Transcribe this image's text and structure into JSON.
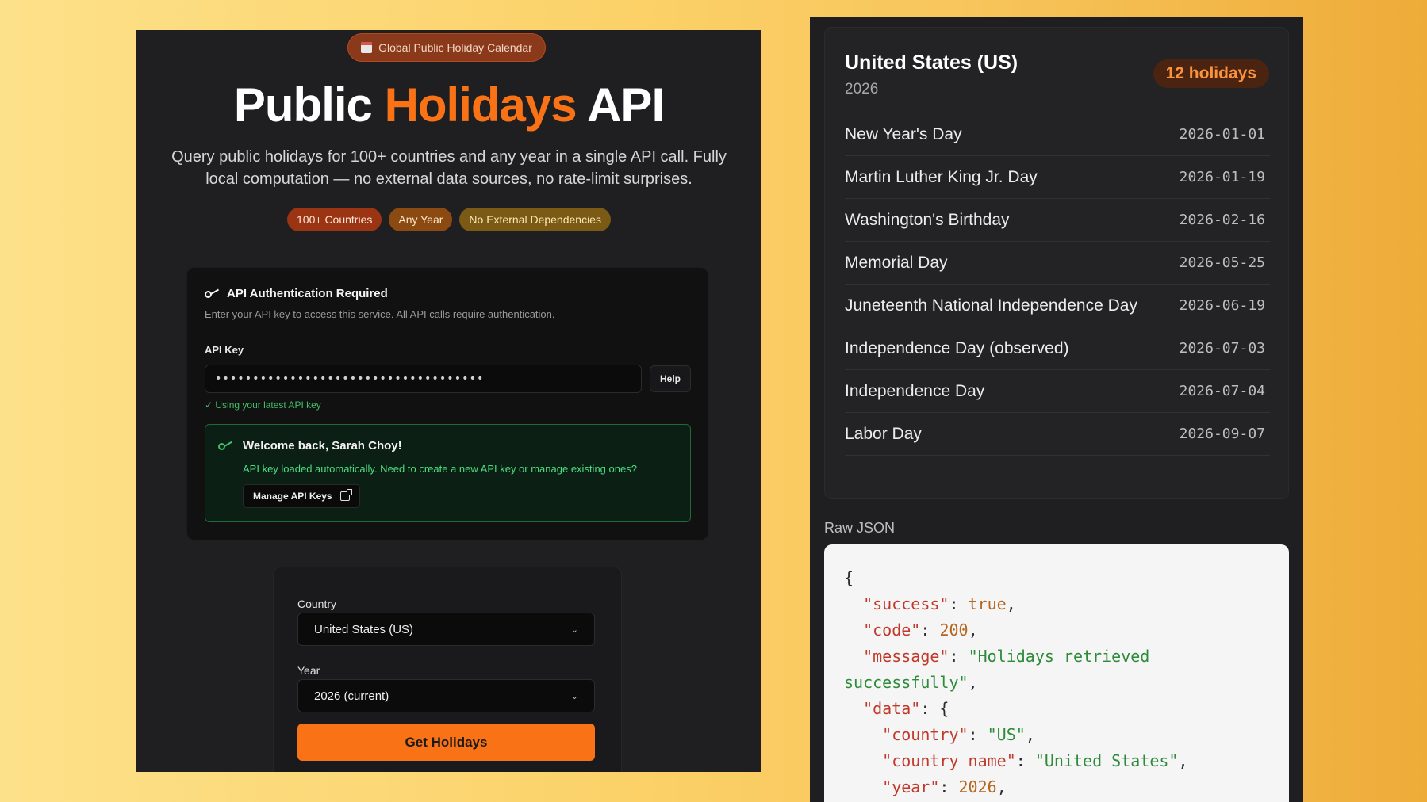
{
  "badge": {
    "label": "Global Public Holiday Calendar"
  },
  "hero": {
    "title_part1": "Public ",
    "title_accent": "Holidays",
    "title_part2": " API",
    "description": "Query public holidays for 100+ countries and any year in a single API call. Fully local computation — no external data sources, no rate-limit surprises."
  },
  "tags": [
    "100+ Countries",
    "Any Year",
    "No External Dependencies"
  ],
  "auth": {
    "title": "API Authentication Required",
    "subtitle": "Enter your API key to access this service. All API calls require authentication.",
    "api_key_label": "API Key",
    "api_key_value": "••••••••••••••••••••••••••••••••••••",
    "help_label": "Help",
    "status": "✓ Using your latest API key",
    "welcome_title": "Welcome back, Sarah Choy!",
    "welcome_text": "API key loaded automatically. Need to create a new API key or manage existing ones?",
    "manage_label": "Manage API Keys"
  },
  "form": {
    "country_label": "Country",
    "country_value": "United States (US)",
    "year_label": "Year",
    "year_value": "2026 (current)",
    "submit_label": "Get Holidays"
  },
  "result": {
    "country": "United States (US)",
    "year": "2026",
    "count_label": "12 holidays",
    "holidays": [
      {
        "name": "New Year's Day",
        "date": "2026-01-01"
      },
      {
        "name": "Martin Luther King Jr. Day",
        "date": "2026-01-19"
      },
      {
        "name": "Washington's Birthday",
        "date": "2026-02-16"
      },
      {
        "name": "Memorial Day",
        "date": "2026-05-25"
      },
      {
        "name": "Juneteenth National Independence Day",
        "date": "2026-06-19"
      },
      {
        "name": "Independence Day (observed)",
        "date": "2026-07-03"
      },
      {
        "name": "Independence Day",
        "date": "2026-07-04"
      },
      {
        "name": "Labor Day",
        "date": "2026-09-07"
      }
    ]
  },
  "raw_json": {
    "label": "Raw JSON",
    "lines": [
      {
        "indent": "",
        "parts": [
          {
            "t": "p",
            "v": "{"
          }
        ]
      },
      {
        "indent": "  ",
        "parts": [
          {
            "t": "k",
            "v": "\"success\""
          },
          {
            "t": "p",
            "v": ": "
          },
          {
            "t": "b",
            "v": "true"
          },
          {
            "t": "p",
            "v": ","
          }
        ]
      },
      {
        "indent": "  ",
        "parts": [
          {
            "t": "k",
            "v": "\"code\""
          },
          {
            "t": "p",
            "v": ": "
          },
          {
            "t": "n",
            "v": "200"
          },
          {
            "t": "p",
            "v": ","
          }
        ]
      },
      {
        "indent": "  ",
        "parts": [
          {
            "t": "k",
            "v": "\"message\""
          },
          {
            "t": "p",
            "v": ": "
          },
          {
            "t": "s",
            "v": "\"Holidays retrieved"
          }
        ]
      },
      {
        "indent": "",
        "parts": [
          {
            "t": "s",
            "v": "successfully\""
          },
          {
            "t": "p",
            "v": ","
          }
        ]
      },
      {
        "indent": "  ",
        "parts": [
          {
            "t": "k",
            "v": "\"data\""
          },
          {
            "t": "p",
            "v": ": {"
          }
        ]
      },
      {
        "indent": "    ",
        "parts": [
          {
            "t": "k",
            "v": "\"country\""
          },
          {
            "t": "p",
            "v": ": "
          },
          {
            "t": "s",
            "v": "\"US\""
          },
          {
            "t": "p",
            "v": ","
          }
        ]
      },
      {
        "indent": "    ",
        "parts": [
          {
            "t": "k",
            "v": "\"country_name\""
          },
          {
            "t": "p",
            "v": ": "
          },
          {
            "t": "s",
            "v": "\"United States\""
          },
          {
            "t": "p",
            "v": ","
          }
        ]
      },
      {
        "indent": "    ",
        "parts": [
          {
            "t": "k",
            "v": "\"year\""
          },
          {
            "t": "p",
            "v": ": "
          },
          {
            "t": "n",
            "v": "2026"
          },
          {
            "t": "p",
            "v": ","
          }
        ]
      }
    ]
  },
  "colors": {
    "accent": "#f97316",
    "success": "#3fbf6a"
  }
}
